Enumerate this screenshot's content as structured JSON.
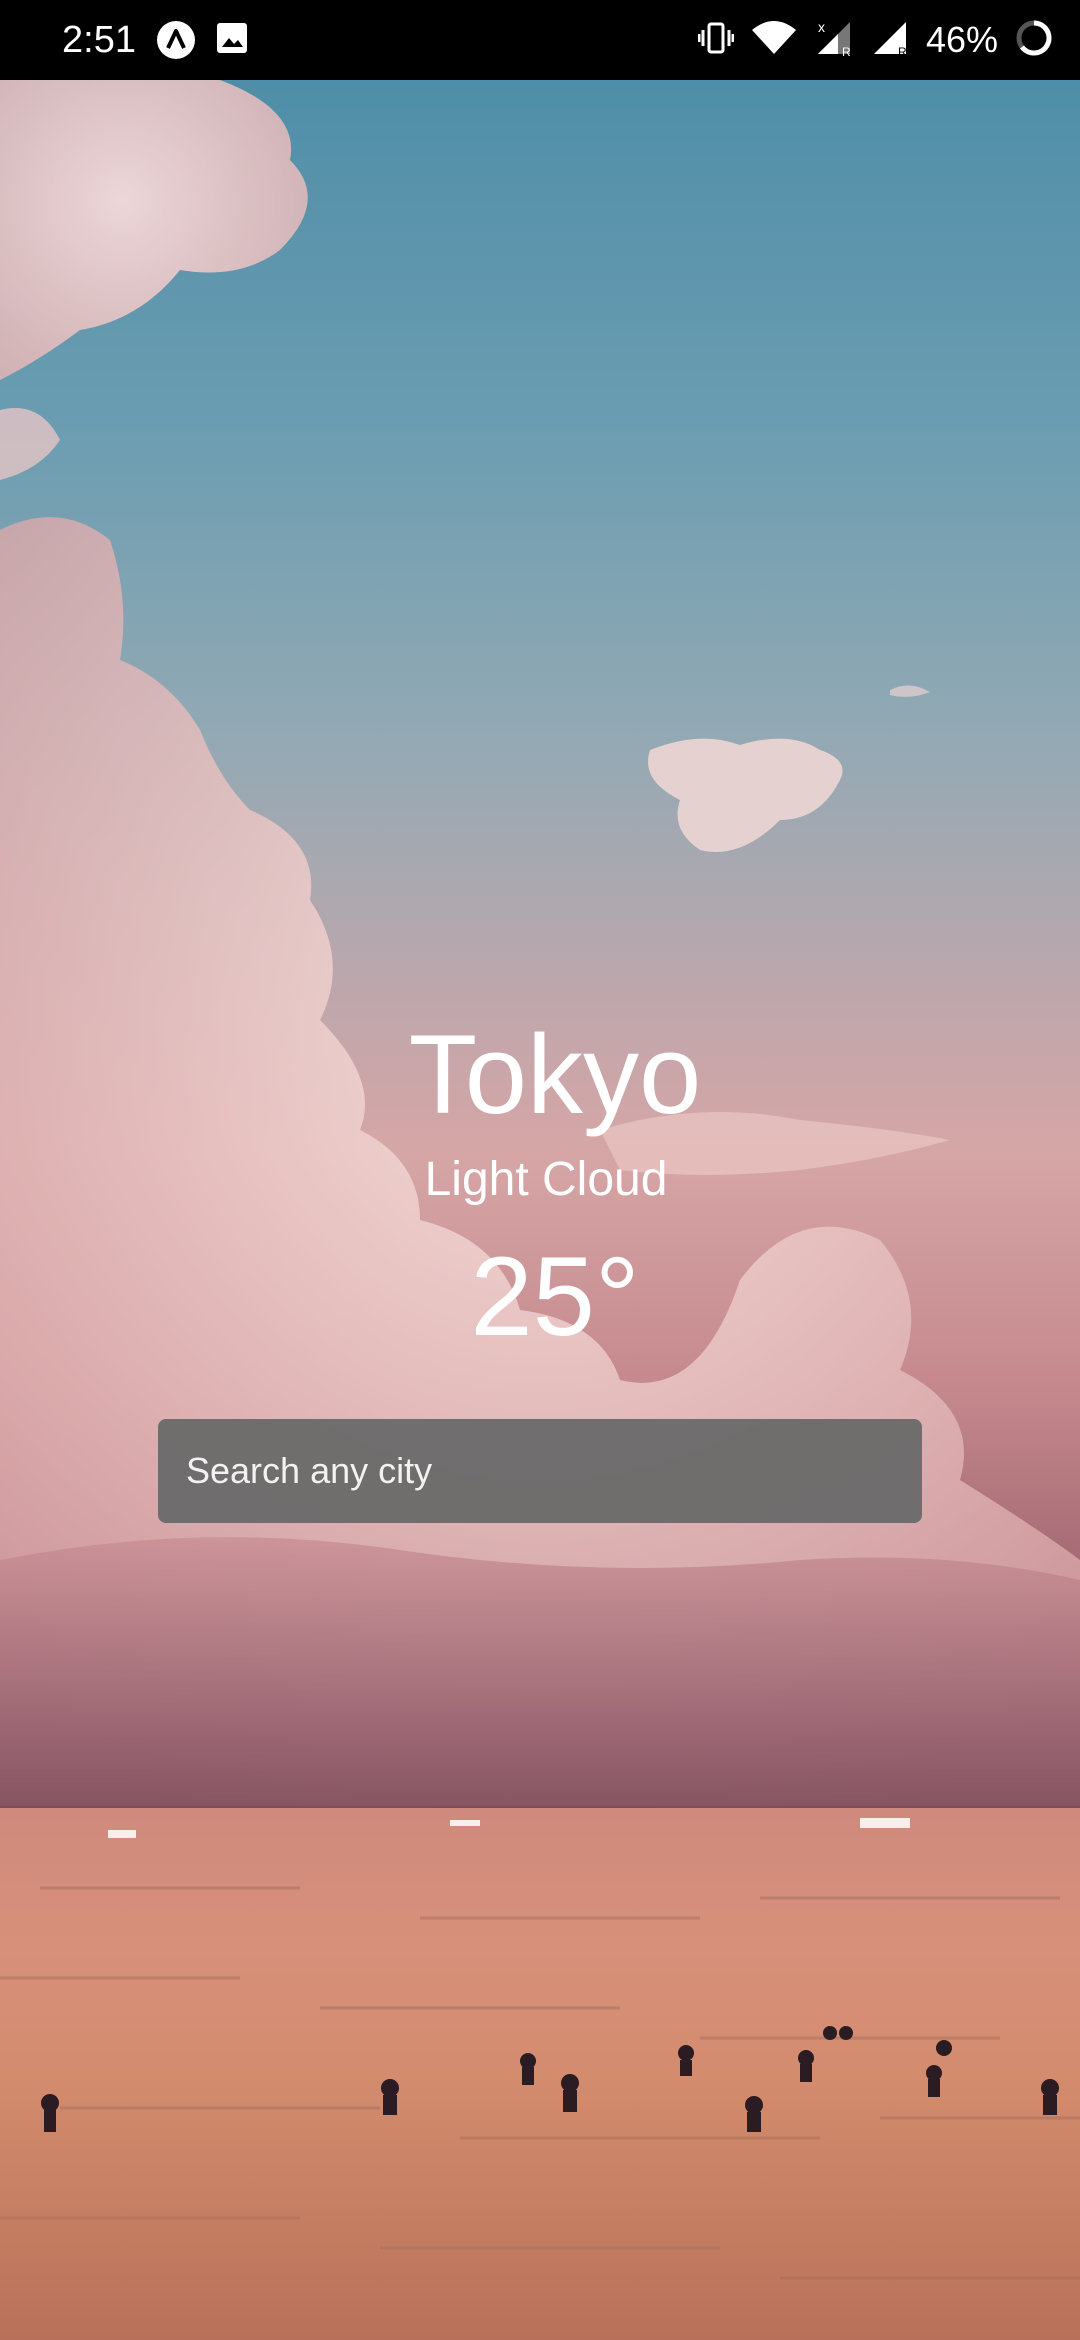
{
  "status_bar": {
    "time": "2:51",
    "left_icons": [
      "app-notification-icon",
      "image-notification-icon"
    ],
    "right_icons": [
      "vibrate-icon",
      "wifi-icon",
      "signal-sim1-icon",
      "signal-sim2-icon",
      "battery-icon"
    ],
    "battery_percent": "46%"
  },
  "weather": {
    "city": "Tokyo",
    "condition": "Light Cloud",
    "temperature": "25°"
  },
  "search": {
    "placeholder": "Search any city",
    "value": ""
  },
  "colors": {
    "status_bar_bg": "#000000",
    "text": "#ffffff",
    "search_bg": "#696969"
  }
}
